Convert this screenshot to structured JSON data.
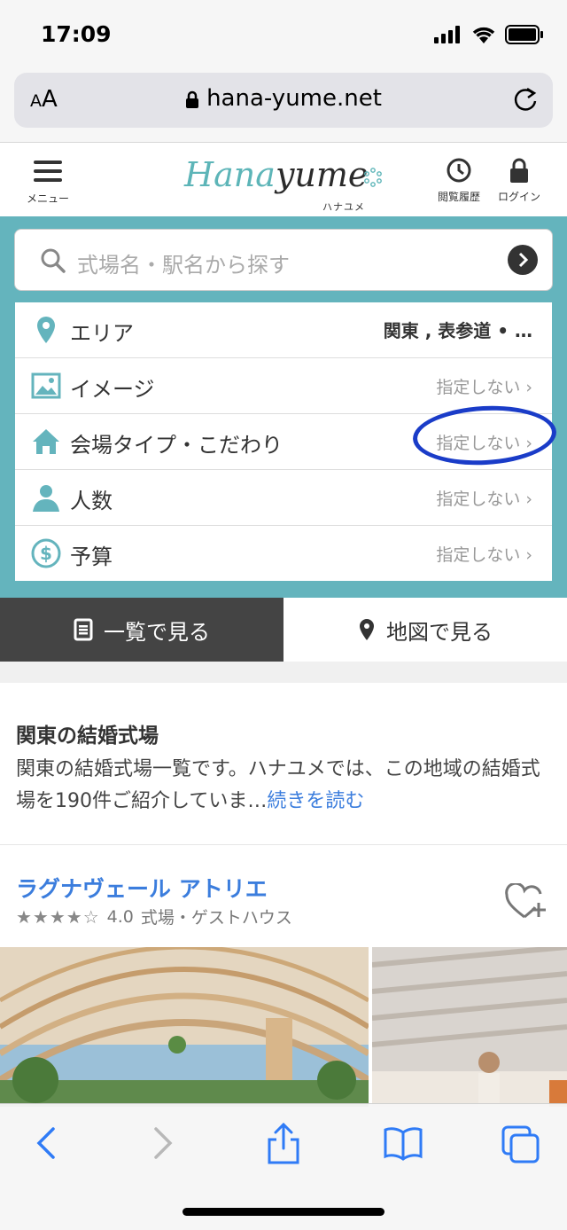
{
  "status_bar": {
    "time": "17:09"
  },
  "browser": {
    "aa_big": "A",
    "aa_small": "A",
    "url": "hana-yume.net"
  },
  "header": {
    "menu_label": "メニュー",
    "logo_word_1": "Hana",
    "logo_word_2": "yume",
    "logo_kana": "ハナユメ",
    "history_label": "閲覧履歴",
    "login_label": "ログイン"
  },
  "search": {
    "placeholder": "式場名・駅名から探す"
  },
  "filters": [
    {
      "label": "エリア",
      "value": "関東 , 表参道 • …",
      "icon": "map-pin-icon"
    },
    {
      "label": "イメージ",
      "value": "指定しない ›",
      "icon": "image-icon"
    },
    {
      "label": "会場タイプ・こだわり",
      "value": "指定しない ›",
      "icon": "home-icon"
    },
    {
      "label": "人数",
      "value": "指定しない ›",
      "icon": "person-icon"
    },
    {
      "label": "予算",
      "value": "指定しない ›",
      "icon": "dollar-icon"
    }
  ],
  "view_tabs": {
    "list": "一覧で見る",
    "map": "地図で見る"
  },
  "description": {
    "title": "関東の結婚式場",
    "text": "関東の結婚式場一覧です。ハナユメでは、この地域の結婚式場を190件ご紹介していま…",
    "more": "続きを読む"
  },
  "listing": {
    "name": "ラグナヴェール アトリエ",
    "stars": "★★★★☆",
    "rating": "4.0",
    "category": "式場・ゲストハウス"
  },
  "colors": {
    "accent": "#64b4bd",
    "link": "#3b7ddd",
    "ios_blue": "#2f7bf6",
    "annotation": "#1a3cc8"
  }
}
